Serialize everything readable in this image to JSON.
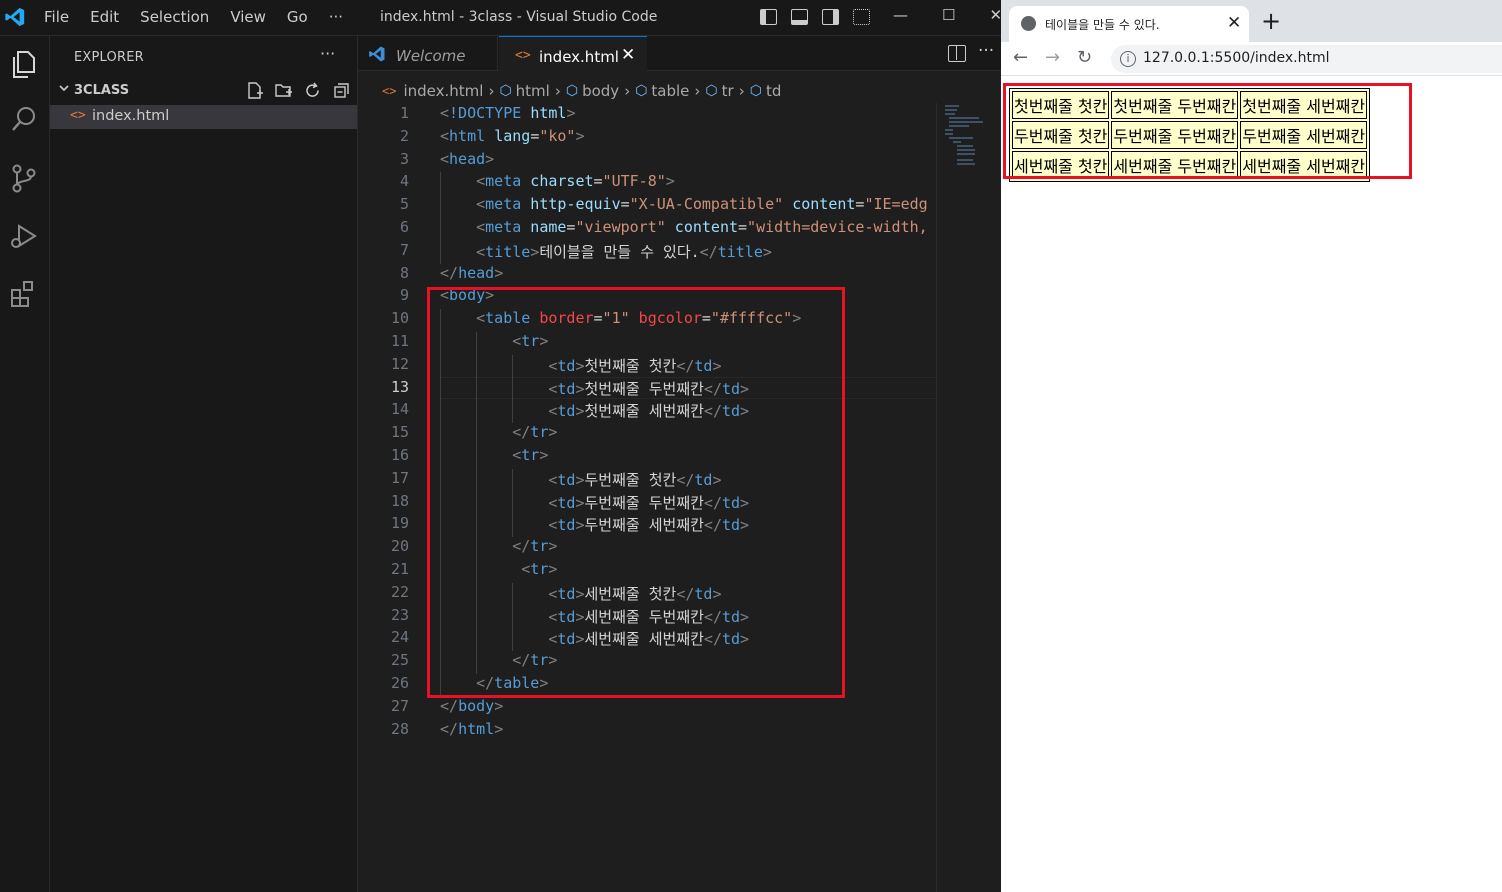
{
  "vscode": {
    "menu": [
      "File",
      "Edit",
      "Selection",
      "View",
      "Go",
      "···"
    ],
    "window_title": "index.html - 3class - Visual Studio Code",
    "window_controls": [
      "—",
      "☐",
      "✕"
    ],
    "explorer": {
      "header": "EXPLORER",
      "more": "···",
      "folder": "3CLASS",
      "files": [
        "index.html"
      ]
    },
    "tabs": [
      {
        "label": "Welcome",
        "active": false
      },
      {
        "label": "index.html",
        "active": true,
        "close": "✕"
      }
    ],
    "tab_more": "···",
    "breadcrumb": [
      "index.html",
      "html",
      "body",
      "table",
      "tr",
      "td"
    ],
    "breadcrumb_sep": "›",
    "current_line": 13,
    "lines": [
      {
        "n": "1",
        "indent": 0,
        "tokens": [
          [
            "p",
            "<"
          ],
          [
            "t",
            "!DOCTYPE"
          ],
          [
            "c",
            " "
          ],
          [
            "a",
            "html"
          ],
          [
            "p",
            ">"
          ]
        ]
      },
      {
        "n": "2",
        "indent": 0,
        "tokens": [
          [
            "p",
            "<"
          ],
          [
            "t",
            "html"
          ],
          [
            "c",
            " "
          ],
          [
            "a",
            "lang"
          ],
          [
            "c",
            "="
          ],
          [
            "s",
            "\"ko\""
          ],
          [
            "p",
            ">"
          ]
        ]
      },
      {
        "n": "3",
        "indent": 0,
        "tokens": [
          [
            "p",
            "<"
          ],
          [
            "t",
            "head"
          ],
          [
            "p",
            ">"
          ]
        ]
      },
      {
        "n": "4",
        "indent": 1,
        "tokens": [
          [
            "p",
            "<"
          ],
          [
            "t",
            "meta"
          ],
          [
            "c",
            " "
          ],
          [
            "a",
            "charset"
          ],
          [
            "c",
            "="
          ],
          [
            "s",
            "\"UTF-8\""
          ],
          [
            "p",
            ">"
          ]
        ]
      },
      {
        "n": "5",
        "indent": 1,
        "tokens": [
          [
            "p",
            "<"
          ],
          [
            "t",
            "meta"
          ],
          [
            "c",
            " "
          ],
          [
            "a",
            "http-equiv"
          ],
          [
            "c",
            "="
          ],
          [
            "s",
            "\"X-UA-Compatible\""
          ],
          [
            "c",
            " "
          ],
          [
            "a",
            "content"
          ],
          [
            "c",
            "="
          ],
          [
            "s",
            "\"IE=edg"
          ]
        ]
      },
      {
        "n": "6",
        "indent": 1,
        "tokens": [
          [
            "p",
            "<"
          ],
          [
            "t",
            "meta"
          ],
          [
            "c",
            " "
          ],
          [
            "a",
            "name"
          ],
          [
            "c",
            "="
          ],
          [
            "s",
            "\"viewport\""
          ],
          [
            "c",
            " "
          ],
          [
            "a",
            "content"
          ],
          [
            "c",
            "="
          ],
          [
            "s",
            "\"width=device-width,"
          ]
        ]
      },
      {
        "n": "7",
        "indent": 1,
        "tokens": [
          [
            "p",
            "<"
          ],
          [
            "t",
            "title"
          ],
          [
            "p",
            ">"
          ],
          [
            "c",
            "테이블을 만들 수 있다."
          ],
          [
            "p",
            "</"
          ],
          [
            "t",
            "title"
          ],
          [
            "p",
            ">"
          ]
        ]
      },
      {
        "n": "8",
        "indent": 0,
        "tokens": [
          [
            "p",
            "</"
          ],
          [
            "t",
            "head"
          ],
          [
            "p",
            ">"
          ]
        ]
      },
      {
        "n": "9",
        "indent": 0,
        "tokens": [
          [
            "p",
            "<"
          ],
          [
            "t",
            "body"
          ],
          [
            "p",
            ">"
          ]
        ]
      },
      {
        "n": "10",
        "indent": 1,
        "tokens": [
          [
            "p",
            "<"
          ],
          [
            "t",
            "table"
          ],
          [
            "c",
            " "
          ],
          [
            "a2",
            "border"
          ],
          [
            "c",
            "="
          ],
          [
            "s",
            "\"1\""
          ],
          [
            "c",
            " "
          ],
          [
            "a2",
            "bgcolor"
          ],
          [
            "c",
            "="
          ],
          [
            "s",
            "\"#ffffcc\""
          ],
          [
            "p",
            ">"
          ]
        ]
      },
      {
        "n": "11",
        "indent": 2,
        "tokens": [
          [
            "p",
            "<"
          ],
          [
            "t",
            "tr"
          ],
          [
            "p",
            ">"
          ]
        ]
      },
      {
        "n": "12",
        "indent": 3,
        "tokens": [
          [
            "p",
            "<"
          ],
          [
            "t",
            "td"
          ],
          [
            "p",
            ">"
          ],
          [
            "c",
            "첫번째줄 첫칸"
          ],
          [
            "p",
            "</"
          ],
          [
            "t",
            "td"
          ],
          [
            "p",
            ">"
          ]
        ]
      },
      {
        "n": "13",
        "indent": 3,
        "tokens": [
          [
            "p",
            "<"
          ],
          [
            "t",
            "td"
          ],
          [
            "p",
            ">"
          ],
          [
            "c",
            "첫번째줄 두번째칸"
          ],
          [
            "p",
            "</"
          ],
          [
            "t",
            "td"
          ],
          [
            "p",
            ">"
          ]
        ]
      },
      {
        "n": "14",
        "indent": 3,
        "tokens": [
          [
            "p",
            "<"
          ],
          [
            "t",
            "td"
          ],
          [
            "p",
            ">"
          ],
          [
            "c",
            "첫번째줄 세번째칸"
          ],
          [
            "p",
            "</"
          ],
          [
            "t",
            "td"
          ],
          [
            "p",
            ">"
          ]
        ]
      },
      {
        "n": "15",
        "indent": 2,
        "tokens": [
          [
            "p",
            "</"
          ],
          [
            "t",
            "tr"
          ],
          [
            "p",
            ">"
          ]
        ]
      },
      {
        "n": "16",
        "indent": 2,
        "tokens": [
          [
            "p",
            "<"
          ],
          [
            "t",
            "tr"
          ],
          [
            "p",
            ">"
          ]
        ]
      },
      {
        "n": "17",
        "indent": 3,
        "tokens": [
          [
            "p",
            "<"
          ],
          [
            "t",
            "td"
          ],
          [
            "p",
            ">"
          ],
          [
            "c",
            "두번째줄 첫칸"
          ],
          [
            "p",
            "</"
          ],
          [
            "t",
            "td"
          ],
          [
            "p",
            ">"
          ]
        ]
      },
      {
        "n": "18",
        "indent": 3,
        "tokens": [
          [
            "p",
            "<"
          ],
          [
            "t",
            "td"
          ],
          [
            "p",
            ">"
          ],
          [
            "c",
            "두번째줄 두번째칸"
          ],
          [
            "p",
            "</"
          ],
          [
            "t",
            "td"
          ],
          [
            "p",
            ">"
          ]
        ]
      },
      {
        "n": "19",
        "indent": 3,
        "tokens": [
          [
            "p",
            "<"
          ],
          [
            "t",
            "td"
          ],
          [
            "p",
            ">"
          ],
          [
            "c",
            "두번째줄 세번째칸"
          ],
          [
            "p",
            "</"
          ],
          [
            "t",
            "td"
          ],
          [
            "p",
            ">"
          ]
        ]
      },
      {
        "n": "20",
        "indent": 2,
        "tokens": [
          [
            "p",
            "</"
          ],
          [
            "t",
            "tr"
          ],
          [
            "p",
            ">"
          ]
        ]
      },
      {
        "n": "21",
        "indent": 2,
        "tokens": [
          [
            "c",
            " "
          ],
          [
            "p",
            "<"
          ],
          [
            "t",
            "tr"
          ],
          [
            "p",
            ">"
          ]
        ]
      },
      {
        "n": "22",
        "indent": 3,
        "tokens": [
          [
            "p",
            "<"
          ],
          [
            "t",
            "td"
          ],
          [
            "p",
            ">"
          ],
          [
            "c",
            "세번째줄 첫칸"
          ],
          [
            "p",
            "</"
          ],
          [
            "t",
            "td"
          ],
          [
            "p",
            ">"
          ]
        ]
      },
      {
        "n": "23",
        "indent": 3,
        "tokens": [
          [
            "p",
            "<"
          ],
          [
            "t",
            "td"
          ],
          [
            "p",
            ">"
          ],
          [
            "c",
            "세번째줄 두번째칸"
          ],
          [
            "p",
            "</"
          ],
          [
            "t",
            "td"
          ],
          [
            "p",
            ">"
          ]
        ]
      },
      {
        "n": "24",
        "indent": 3,
        "tokens": [
          [
            "p",
            "<"
          ],
          [
            "t",
            "td"
          ],
          [
            "p",
            ">"
          ],
          [
            "c",
            "세번째줄 세번째칸"
          ],
          [
            "p",
            "</"
          ],
          [
            "t",
            "td"
          ],
          [
            "p",
            ">"
          ]
        ]
      },
      {
        "n": "25",
        "indent": 2,
        "tokens": [
          [
            "p",
            "</"
          ],
          [
            "t",
            "tr"
          ],
          [
            "p",
            ">"
          ]
        ]
      },
      {
        "n": "26",
        "indent": 1,
        "tokens": [
          [
            "p",
            "</"
          ],
          [
            "t",
            "table"
          ],
          [
            "p",
            ">"
          ]
        ]
      },
      {
        "n": "27",
        "indent": 0,
        "tokens": [
          [
            "p",
            "</"
          ],
          [
            "t",
            "body"
          ],
          [
            "p",
            ">"
          ]
        ]
      },
      {
        "n": "28",
        "indent": 0,
        "tokens": [
          [
            "p",
            "</"
          ],
          [
            "t",
            "html"
          ],
          [
            "p",
            ">"
          ]
        ]
      }
    ]
  },
  "browser": {
    "tab_title": "테이블을 만들 수 있다.",
    "tab_close": "✕",
    "new_tab": "+",
    "nav": {
      "back": "←",
      "forward": "→",
      "reload": "↻"
    },
    "url_info": "i",
    "url": "127.0.0.1:5500/index.html",
    "table": {
      "bgcolor": "#ffffcc",
      "rows": [
        [
          "첫번째줄 첫칸",
          "첫번째줄 두번째칸",
          "첫번째줄 세번째칸"
        ],
        [
          "두번째줄 첫칸",
          "두번째줄 두번째칸",
          "두번째줄 세번째칸"
        ],
        [
          "세번째줄 첫칸",
          "세번째줄 두번째칸",
          "세번째줄 세번째칸"
        ]
      ]
    }
  },
  "colors": {
    "highlight_box": "#e81123",
    "accent": "#0078d4"
  }
}
